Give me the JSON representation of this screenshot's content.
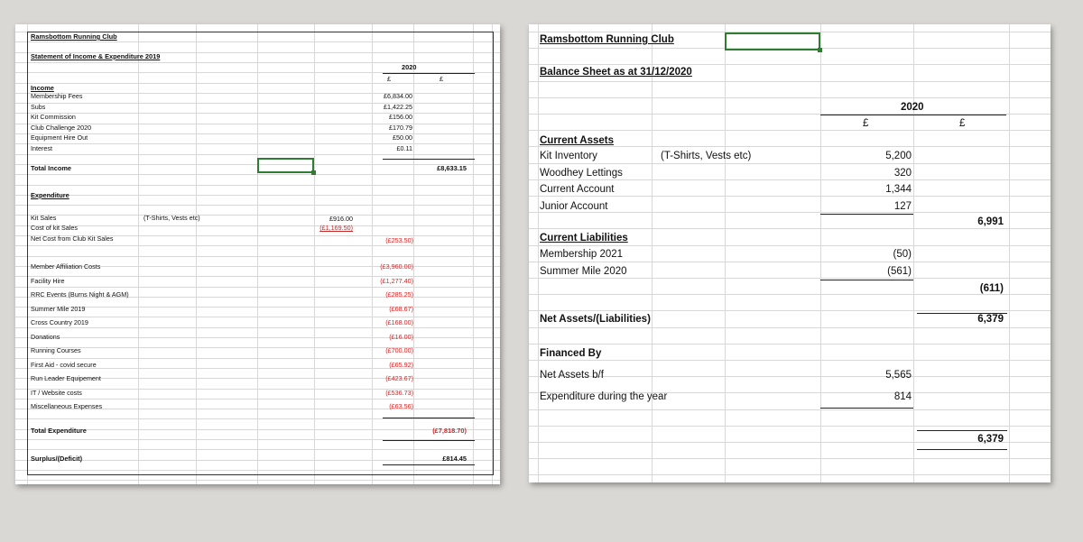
{
  "income_statement": {
    "club_name": "Ramsbottom Running Club",
    "title": "Statement of Income & Expenditure 2019",
    "year": "2020",
    "currency_1": "£",
    "currency_2": "£",
    "income_heading": "Income",
    "income_items": [
      {
        "label": "Membership Fees",
        "value": "£6,834.00"
      },
      {
        "label": "Subs",
        "value": "£1,422.25"
      },
      {
        "label": "Kit Commission",
        "value": "£156.00"
      },
      {
        "label": "Club Challenge 2020",
        "value": "£170.79"
      },
      {
        "label": "Equipment Hire Out",
        "value": "£50.00"
      },
      {
        "label": "Interest",
        "value": "£0.11"
      }
    ],
    "total_income_label": "Total Income",
    "total_income_value": "£8,633.15",
    "expenditure_heading": "Expenditure",
    "kit_sales_label": "Kit Sales",
    "kit_sales_note": "(T-Shirts, Vests etc)",
    "kit_sales_value": "£916.00",
    "cost_of_kit_label": "Cost of kit Sales",
    "cost_of_kit_value": "(£1,169.50)",
    "net_cost_kit_label": "Net Cost from Club Kit Sales",
    "net_cost_kit_value": "(£253.50)",
    "expense_items": [
      {
        "label": "Member Affiliation Costs",
        "value": "(£3,960.00)"
      },
      {
        "label": "Facility Hire",
        "value": "(£1,277.40)"
      },
      {
        "label": "RRC Events (Burns Night & AGM)",
        "value": "(£285.25)"
      },
      {
        "label": "Summer Mile 2019",
        "value": "(£68.67)"
      },
      {
        "label": "Cross Country 2019",
        "value": "(£168.00)"
      },
      {
        "label": "Donations",
        "value": "(£16.00)"
      },
      {
        "label": "Running Courses",
        "value": "(£700.00)"
      },
      {
        "label": "First Aid - covid secure",
        "value": "(£65.92)"
      },
      {
        "label": "Run Leader Equipement",
        "value": "(£423.67)"
      },
      {
        "label": "IT / Website costs",
        "value": "(£536.73)"
      },
      {
        "label": "Miscellaneous Expenses",
        "value": "(£63.56)"
      }
    ],
    "total_expenditure_label": "Total Expenditure",
    "total_expenditure_value": "(£7,818.70)",
    "surplus_label": "Surplus/(Deficit)",
    "surplus_value": "£814.45"
  },
  "balance_sheet": {
    "club_name": "Ramsbottom Running Club",
    "title": "Balance Sheet as at 31/12/2020",
    "year": "2020",
    "currency_1": "£",
    "currency_2": "£",
    "current_assets_heading": "Current Assets",
    "current_assets": [
      {
        "label": "Kit Inventory",
        "note": "(T-Shirts, Vests etc)",
        "value": "5,200"
      },
      {
        "label": "Woodhey Lettings",
        "note": "",
        "value": "320"
      },
      {
        "label": "Current Account",
        "note": "",
        "value": "1,344"
      },
      {
        "label": "Junior Account",
        "note": "",
        "value": "127"
      }
    ],
    "current_assets_total": "6,991",
    "current_liabilities_heading": "Current Liabilities",
    "current_liabilities": [
      {
        "label": "Membership 2021",
        "value": "(50)"
      },
      {
        "label": "Summer Mile 2020",
        "value": "(561)"
      }
    ],
    "current_liabilities_total": "(611)",
    "net_assets_label": "Net Assets/(Liabilities)",
    "net_assets_value": "6,379",
    "financed_by_heading": "Financed By",
    "net_assets_bf_label": "Net Assets b/f",
    "net_assets_bf_value": "5,565",
    "expenditure_year_label": "Expenditure during the year",
    "expenditure_year_value": "814",
    "final_total": "6,379"
  }
}
